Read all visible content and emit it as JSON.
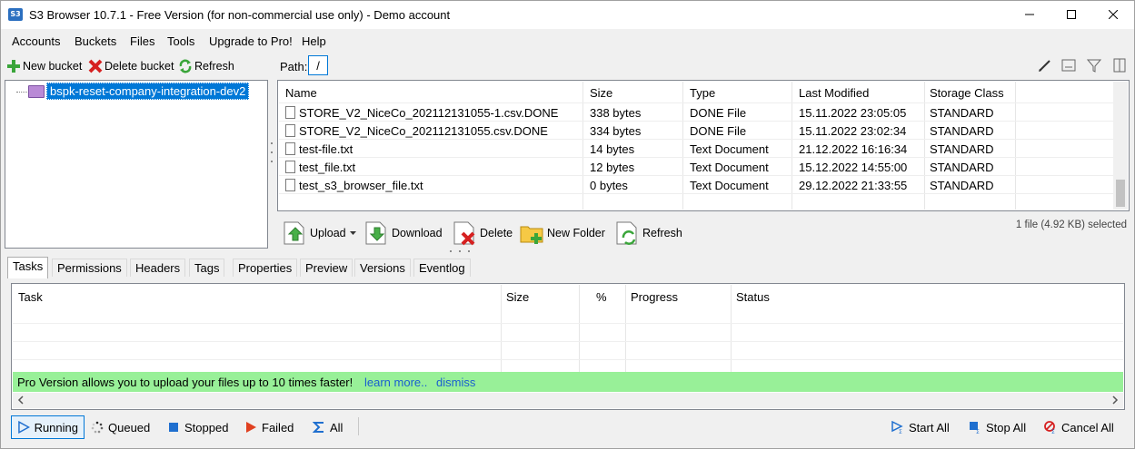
{
  "window": {
    "title": "S3 Browser 10.7.1 - Free Version (for non-commercial use only) - Demo account",
    "app_icon_text": "S3"
  },
  "menu": [
    "Accounts",
    "Buckets",
    "Files",
    "Tools",
    "Upgrade to Pro!",
    "Help"
  ],
  "bucket_toolbar": {
    "new_bucket": "New bucket",
    "delete_bucket": "Delete bucket",
    "refresh": "Refresh"
  },
  "tree": {
    "selected_bucket": "bspk-reset-company-integration-dev2"
  },
  "path": {
    "label": "Path:",
    "value": "/"
  },
  "file_list": {
    "columns": [
      "Name",
      "Size",
      "Type",
      "Last Modified",
      "Storage Class"
    ],
    "rows": [
      {
        "name": "STORE_V2_NiceCo_202112131055-1.csv.DONE",
        "size": "338 bytes",
        "type": "DONE File",
        "modified": "15.11.2022 23:05:05",
        "storage": "STANDARD"
      },
      {
        "name": "STORE_V2_NiceCo_202112131055.csv.DONE",
        "size": "334 bytes",
        "type": "DONE File",
        "modified": "15.11.2022 23:02:34",
        "storage": "STANDARD"
      },
      {
        "name": "test-file.txt",
        "size": "14 bytes",
        "type": "Text Document",
        "modified": "21.12.2022 16:16:34",
        "storage": "STANDARD"
      },
      {
        "name": "test_file.txt",
        "size": "12 bytes",
        "type": "Text Document",
        "modified": "15.12.2022 14:55:00",
        "storage": "STANDARD"
      },
      {
        "name": "test_s3_browser_file.txt",
        "size": "0 bytes",
        "type": "Text Document",
        "modified": "29.12.2022 21:33:55",
        "storage": "STANDARD"
      }
    ]
  },
  "file_actions": {
    "upload": "Upload",
    "download": "Download",
    "delete": "Delete",
    "new_folder": "New Folder",
    "refresh": "Refresh",
    "selection_status": "1 file (4.92 KB) selected"
  },
  "tabs": [
    "Tasks",
    "Permissions",
    "Headers",
    "Tags",
    "Properties",
    "Preview",
    "Versions",
    "Eventlog"
  ],
  "active_tab": "Tasks",
  "tasks": {
    "columns": [
      "Task",
      "Size",
      "%",
      "Progress",
      "Status"
    ],
    "promo_text": "Pro Version allows you to upload your files up to 10 times faster!",
    "learn_more": "learn more..",
    "dismiss": "dismiss"
  },
  "bottom_bar": {
    "running": "Running",
    "queued": "Queued",
    "stopped": "Stopped",
    "failed": "Failed",
    "all": "All",
    "start_all": "Start All",
    "stop_all": "Stop All",
    "cancel_all": "Cancel All"
  },
  "colors": {
    "selection": "#0078d7",
    "promo_bg": "#98f098",
    "link": "#1a5fd0"
  }
}
